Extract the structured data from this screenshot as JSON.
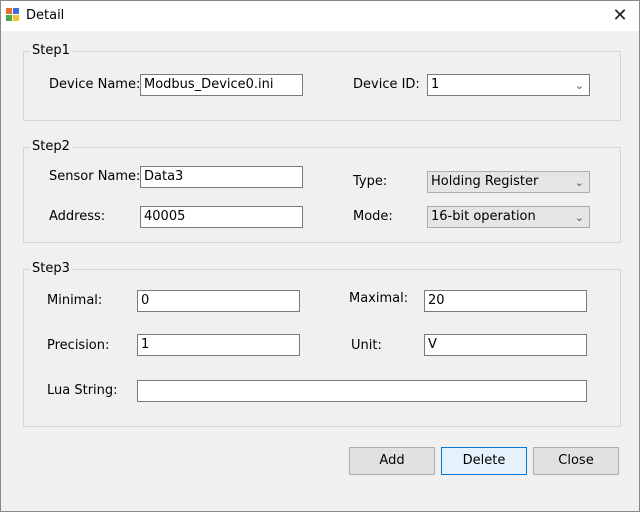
{
  "window": {
    "title": "Detail",
    "close_glyph": "✕"
  },
  "step1": {
    "title": "Step1",
    "device_name_label": "Device Name:",
    "device_name_value": "Modbus_Device0.ini",
    "device_id_label": "Device ID:",
    "device_id_value": "1"
  },
  "step2": {
    "title": "Step2",
    "sensor_name_label": "Sensor Name:",
    "sensor_name_value": "Data3",
    "type_label": "Type:",
    "type_value": "Holding Register",
    "address_label": "Address:",
    "address_value": "40005",
    "mode_label": "Mode:",
    "mode_value": "16-bit operation"
  },
  "step3": {
    "title": "Step3",
    "minimal_label": "Minimal:",
    "minimal_value": "0",
    "maximal_label": "Maximal:",
    "maximal_value": "20",
    "precision_label": "Precision:",
    "precision_value": "1",
    "unit_label": "Unit:",
    "unit_value": "V",
    "lua_label": "Lua String:",
    "lua_value": ""
  },
  "buttons": {
    "add": "Add",
    "delete": "Delete",
    "close": "Close"
  },
  "icons": {
    "chevron": "chevron-down-icon",
    "app": "app-icon",
    "close": "close-icon"
  }
}
